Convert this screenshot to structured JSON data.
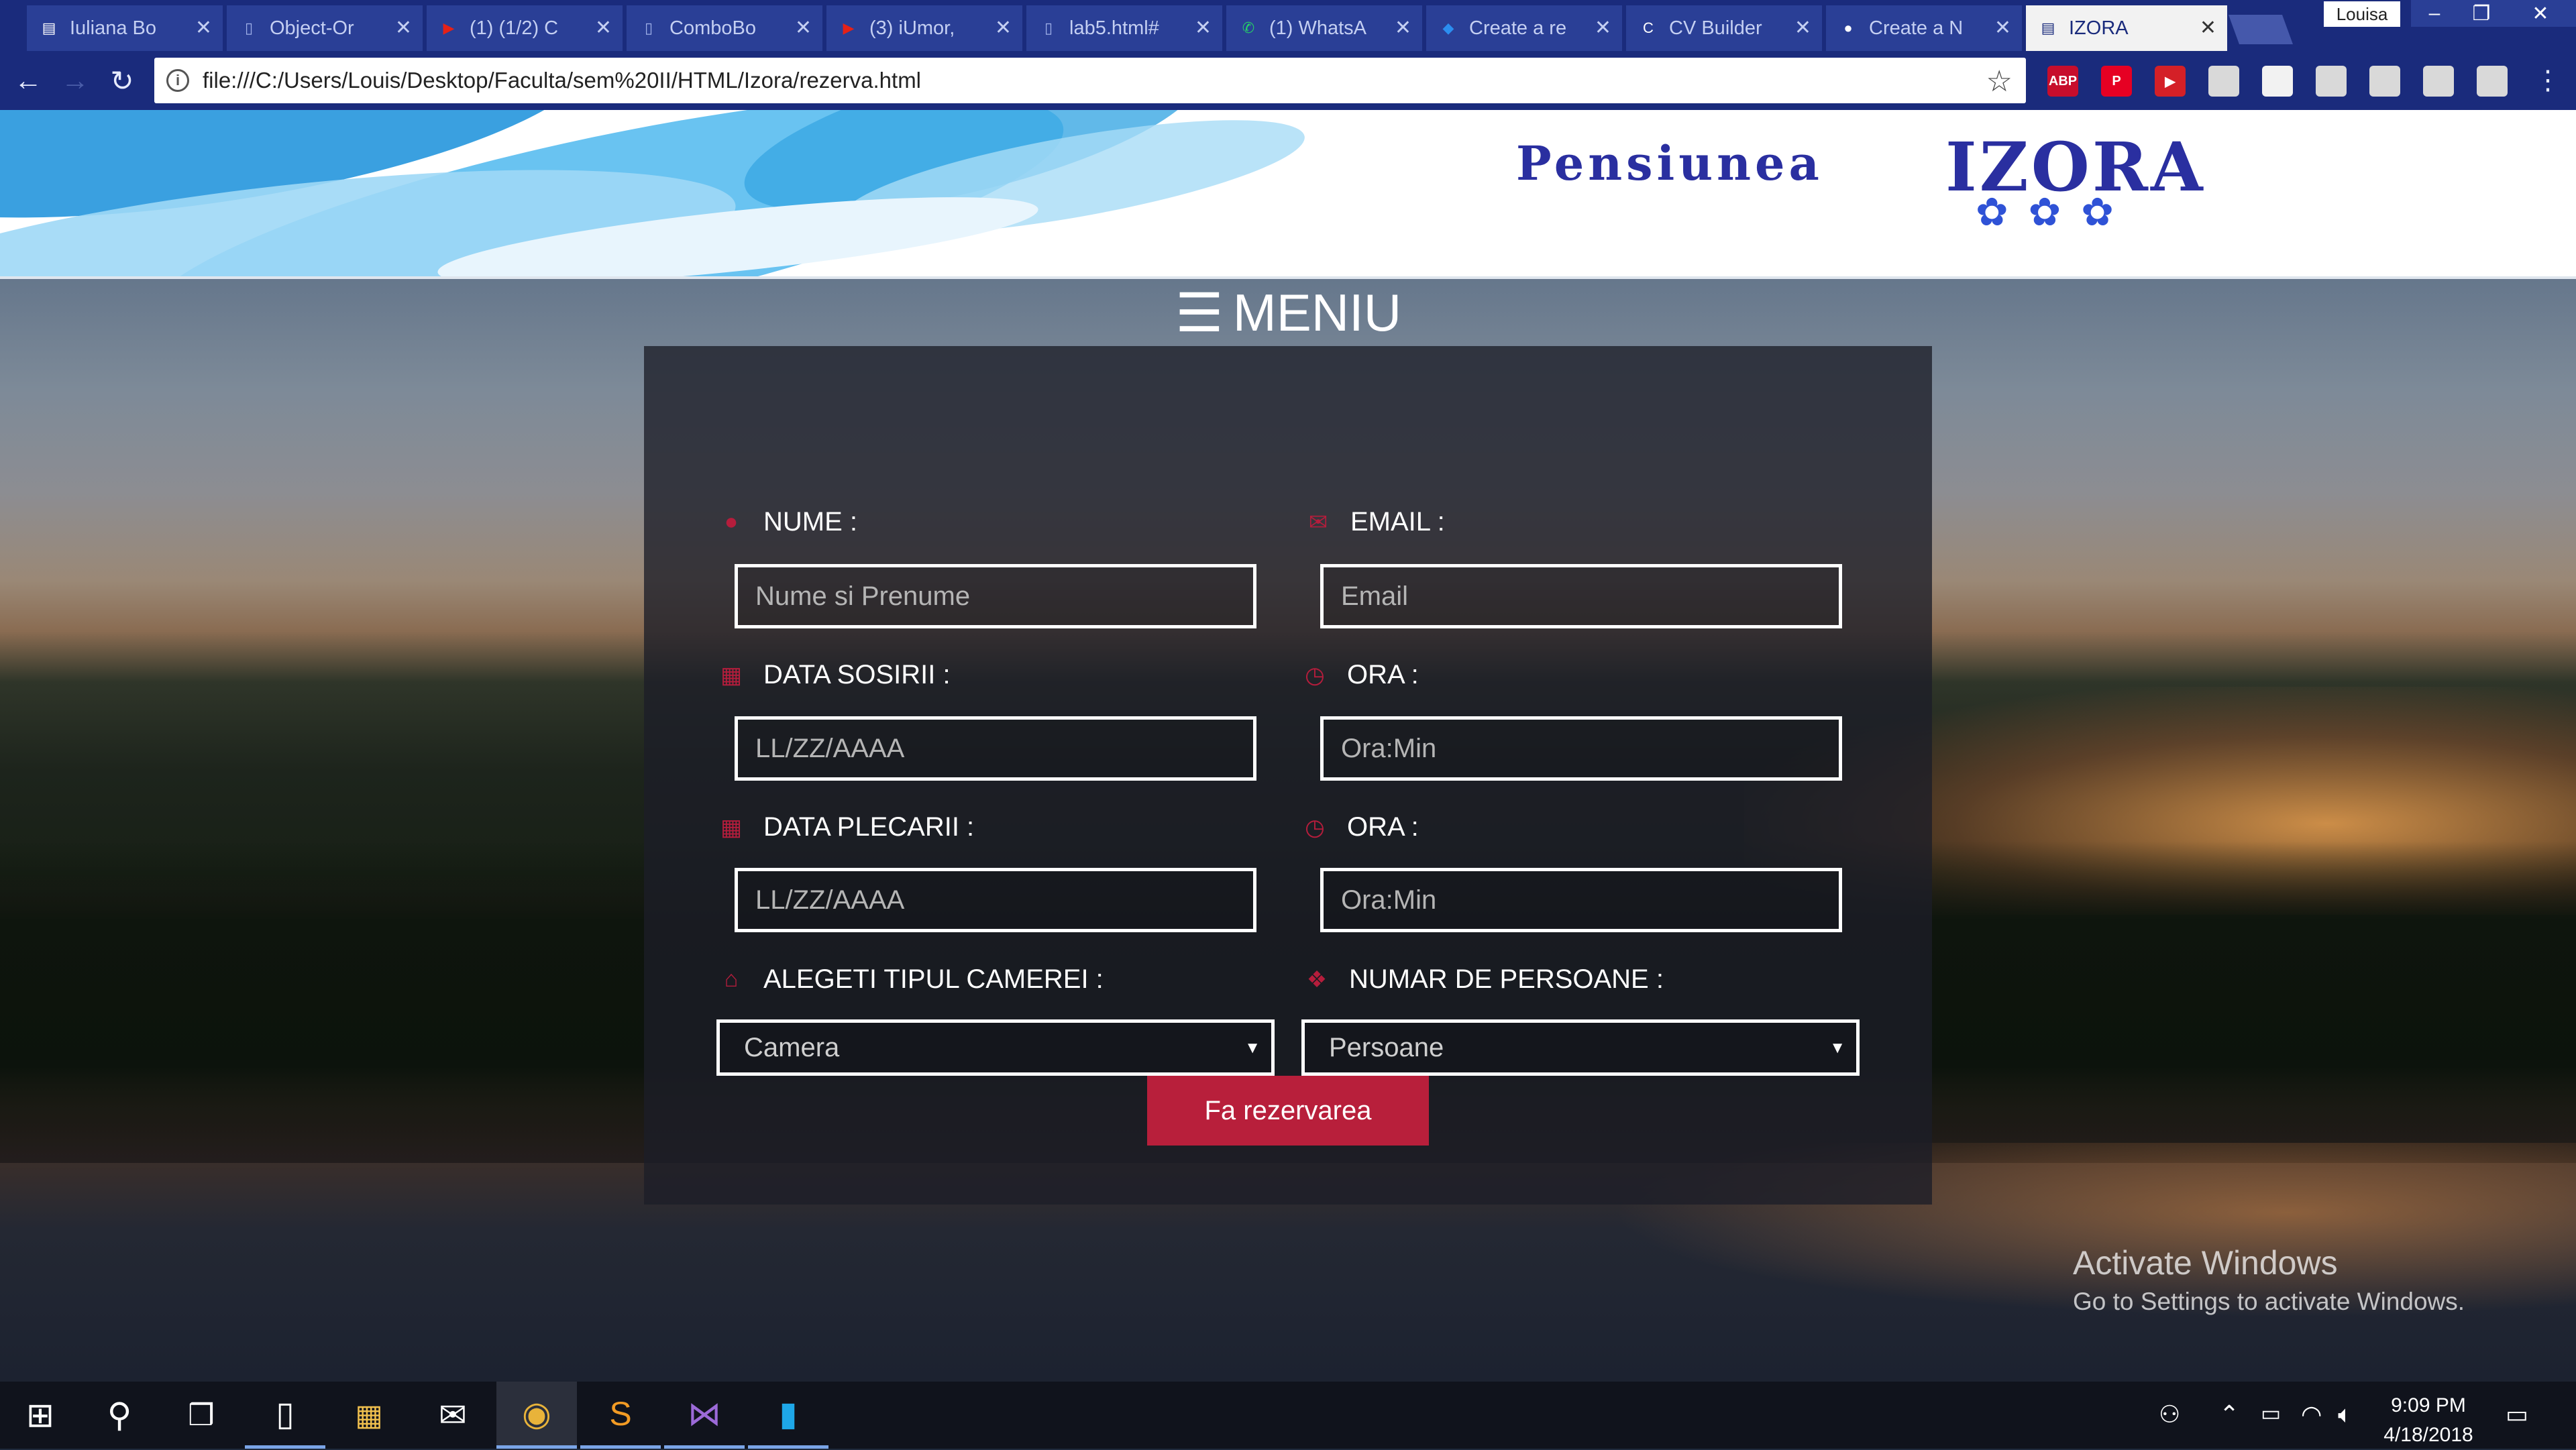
{
  "browser": {
    "tabs": [
      {
        "label": "Iuliana Bo",
        "icon": "trello-icon",
        "active": false
      },
      {
        "label": "Object-Or",
        "icon": "document-icon",
        "active": false
      },
      {
        "label": "(1) (1/2) C",
        "icon": "youtube-icon",
        "active": false
      },
      {
        "label": "ComboBo",
        "icon": "document-icon",
        "active": false
      },
      {
        "label": "(3) iUmor,",
        "icon": "youtube-icon",
        "active": false
      },
      {
        "label": "lab5.html#",
        "icon": "document-icon",
        "active": false
      },
      {
        "label": "(1) WhatsA",
        "icon": "whatsapp-icon",
        "active": false
      },
      {
        "label": "Create a re",
        "icon": "codepen-icon",
        "active": false
      },
      {
        "label": "CV Builder",
        "icon": "cv-icon",
        "active": false
      },
      {
        "label": "Create a N",
        "icon": "github-icon",
        "active": false
      },
      {
        "label": "IZORA",
        "icon": "page-icon",
        "active": true
      }
    ],
    "profile_name": "Louisa",
    "url": "file:///C:/Users/Louis/Desktop/Faculta/sem%20II/HTML/Izora/rezerva.html",
    "extensions": [
      {
        "name": "adblock-plus-icon",
        "text": "ABP",
        "color": "#c70d2c"
      },
      {
        "name": "pinterest-icon",
        "text": "P",
        "color": "#e60023"
      },
      {
        "name": "video-downloader-icon",
        "text": "▶",
        "color": "#d42027"
      },
      {
        "name": "extension-icon-1",
        "text": "",
        "color": "#d9d9d9"
      },
      {
        "name": "extension-icon-2",
        "text": "",
        "color": "#f2f2f2"
      },
      {
        "name": "extension-icon-3",
        "text": "",
        "color": "#d9d9d9"
      },
      {
        "name": "extension-icon-4",
        "text": "",
        "color": "#d9d9d9"
      },
      {
        "name": "extension-icon-5",
        "text": "",
        "color": "#d9d9d9"
      },
      {
        "name": "extension-icon-6",
        "text": "",
        "color": "#d9d9d9"
      }
    ]
  },
  "site": {
    "logo": {
      "word1": "Pensiunea",
      "word2": "IZORA",
      "flowers": "✿✿✿"
    },
    "menu_label": "MENIU"
  },
  "form": {
    "name_label": "NUME :",
    "name_placeholder": "Nume si Prenume",
    "email_label": "EMAIL :",
    "email_placeholder": "Email",
    "arrival_label": "DATA SOSIRII :",
    "arrival_placeholder": "LL/ZZ/AAAA",
    "arrival_time_label": "ORA :",
    "arrival_time_placeholder": "Ora:Min",
    "departure_label": "DATA PLECARII :",
    "departure_placeholder": "LL/ZZ/AAAA",
    "departure_time_label": "ORA :",
    "departure_time_placeholder": "Ora:Min",
    "room_label": "ALEGETI TIPUL CAMEREI :",
    "room_selected": "Camera",
    "persons_label": "NUMAR DE PERSOANE :",
    "persons_selected": "Persoane",
    "submit_label": "Fa rezervarea",
    "accent_color": "#b81f3b"
  },
  "watermark": {
    "line1": "Activate Windows",
    "line2": "Go to Settings to activate Windows."
  },
  "taskbar": {
    "time": "9:09 PM",
    "date": "4/18/2018"
  }
}
